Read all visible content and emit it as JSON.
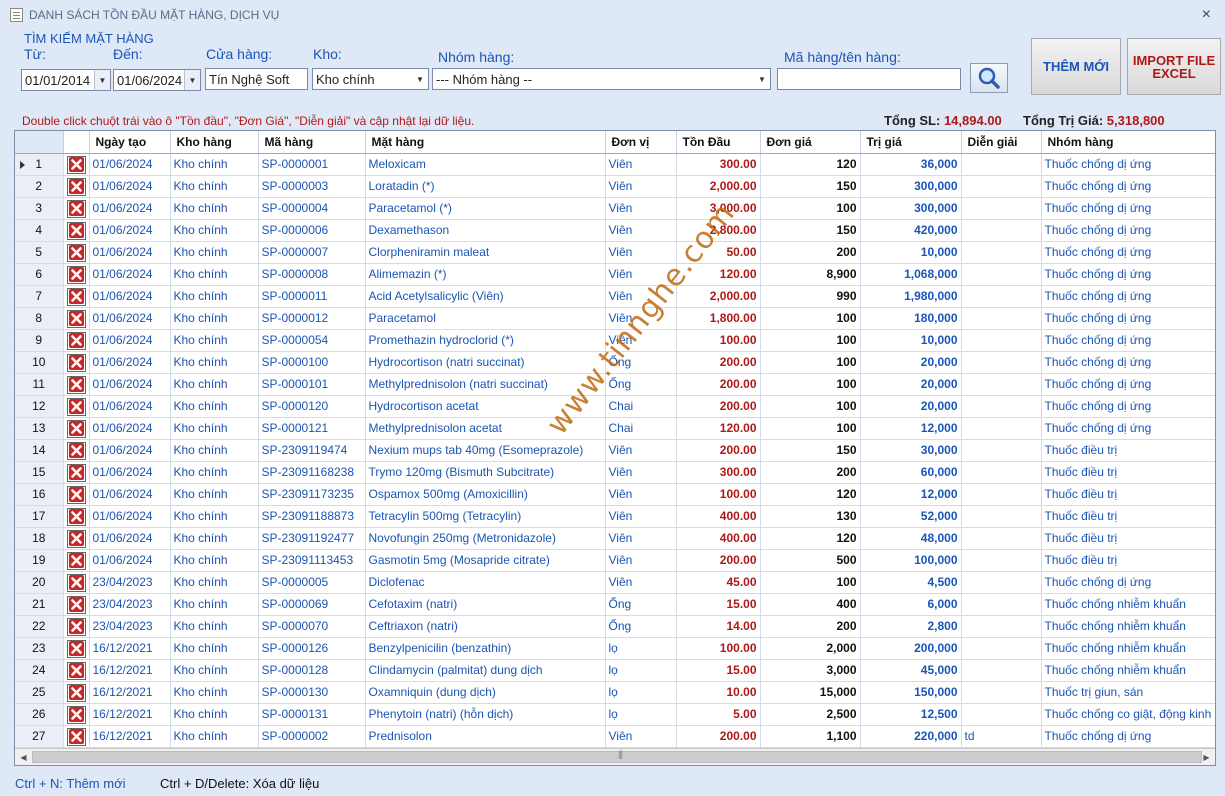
{
  "window": {
    "title": "DANH SÁCH TỒN ĐẦU MẶT HÀNG, DỊCH VỤ",
    "close": "×"
  },
  "search": {
    "section_label": "TÌM KIẾM MẶT HÀNG",
    "from_label": "Từ:",
    "to_label": "Đến:",
    "store_label": "Cửa hàng:",
    "warehouse_label": "Kho:",
    "group_label": "Nhóm hàng:",
    "code_label": "Mã hàng/tên hàng:",
    "from_value": "01/01/2014",
    "to_value": "01/06/2024",
    "store_value": "Tín Nghệ Soft",
    "warehouse_value": "Kho chính",
    "group_value": "--- Nhóm hàng --",
    "code_value": ""
  },
  "buttons": {
    "add_new": "THÊM MỚI",
    "import_line1": "IMPORT FILE",
    "import_line2": "EXCEL"
  },
  "hint": "Double click chuột trái vào ô \"Tồn đầu\", \"Đơn Giá\", \"Diễn giải\" và cập nhật lại dữ liệu.",
  "totals": {
    "qty_label": "Tổng SL:",
    "qty_value": "14,894.00",
    "value_label": "Tổng Trị Giá:",
    "value_value": "5,318,800"
  },
  "table": {
    "headers": {
      "date": "Ngày tạo",
      "warehouse": "Kho hàng",
      "code": "Mã hàng",
      "name": "Mặt hàng",
      "unit": "Đơn vị",
      "opening": "Tồn Đầu",
      "price": "Đơn giá",
      "value": "Trị giá",
      "note": "Diễn giải",
      "group": "Nhóm hàng"
    },
    "rows": [
      [
        "1",
        "01/06/2024",
        "Kho chính",
        "SP-0000001",
        "Meloxicam",
        "Viên",
        "300.00",
        "120",
        "36,000",
        "",
        "Thuốc chống dị ứng"
      ],
      [
        "2",
        "01/06/2024",
        "Kho chính",
        "SP-0000003",
        "Loratadin (*)",
        "Viên",
        "2,000.00",
        "150",
        "300,000",
        "",
        "Thuốc chống dị ứng"
      ],
      [
        "3",
        "01/06/2024",
        "Kho chính",
        "SP-0000004",
        "Paracetamol (*)",
        "Viên",
        "3,000.00",
        "100",
        "300,000",
        "",
        "Thuốc chống dị ứng"
      ],
      [
        "4",
        "01/06/2024",
        "Kho chính",
        "SP-0000006",
        "Dexamethason",
        "Viên",
        "2,800.00",
        "150",
        "420,000",
        "",
        "Thuốc chống dị ứng"
      ],
      [
        "5",
        "01/06/2024",
        "Kho chính",
        "SP-0000007",
        "Clorpheniramin maleat",
        "Viên",
        "50.00",
        "200",
        "10,000",
        "",
        "Thuốc chống dị ứng"
      ],
      [
        "6",
        "01/06/2024",
        "Kho chính",
        "SP-0000008",
        "Alimemazin (*)",
        "Viên",
        "120.00",
        "8,900",
        "1,068,000",
        "",
        "Thuốc chống dị ứng"
      ],
      [
        "7",
        "01/06/2024",
        "Kho chính",
        "SP-0000011",
        "Acid Acetylsalicylic (Viên)",
        "Viên",
        "2,000.00",
        "990",
        "1,980,000",
        "",
        "Thuốc chống dị ứng"
      ],
      [
        "8",
        "01/06/2024",
        "Kho chính",
        "SP-0000012",
        "Paracetamol",
        "Viên",
        "1,800.00",
        "100",
        "180,000",
        "",
        "Thuốc chống dị ứng"
      ],
      [
        "9",
        "01/06/2024",
        "Kho chính",
        "SP-0000054",
        "Promethazin hydroclorid (*)",
        "Viên",
        "100.00",
        "100",
        "10,000",
        "",
        "Thuốc chống dị ứng"
      ],
      [
        "10",
        "01/06/2024",
        "Kho chính",
        "SP-0000100",
        "Hydrocortison (natri succinat)",
        "Ống",
        "200.00",
        "100",
        "20,000",
        "",
        "Thuốc chống dị ứng"
      ],
      [
        "11",
        "01/06/2024",
        "Kho chính",
        "SP-0000101",
        "Methylprednisolon (natri succinat)",
        "Ống",
        "200.00",
        "100",
        "20,000",
        "",
        "Thuốc chống dị ứng"
      ],
      [
        "12",
        "01/06/2024",
        "Kho chính",
        "SP-0000120",
        "Hydrocortison acetat",
        "Chai",
        "200.00",
        "100",
        "20,000",
        "",
        "Thuốc chống dị ứng"
      ],
      [
        "13",
        "01/06/2024",
        "Kho chính",
        "SP-0000121",
        "Methylprednisolon acetat",
        "Chai",
        "120.00",
        "100",
        "12,000",
        "",
        "Thuốc chống dị ứng"
      ],
      [
        "14",
        "01/06/2024",
        "Kho chính",
        "SP-2309119474",
        "Nexium mups tab 40mg (Esomeprazole)",
        "Viên",
        "200.00",
        "150",
        "30,000",
        "",
        "Thuốc điều trị"
      ],
      [
        "15",
        "01/06/2024",
        "Kho chính",
        "SP-23091168238",
        "Trymo 120mg (Bismuth Subcitrate)",
        "Viên",
        "300.00",
        "200",
        "60,000",
        "",
        "Thuốc điều trị"
      ],
      [
        "16",
        "01/06/2024",
        "Kho chính",
        "SP-23091173235",
        "Ospamox 500mg (Amoxicillin)",
        "Viên",
        "100.00",
        "120",
        "12,000",
        "",
        "Thuốc điều trị"
      ],
      [
        "17",
        "01/06/2024",
        "Kho chính",
        "SP-23091188873",
        "Tetracylin 500mg (Tetracylin)",
        "Viên",
        "400.00",
        "130",
        "52,000",
        "",
        "Thuốc điều trị"
      ],
      [
        "18",
        "01/06/2024",
        "Kho chính",
        "SP-23091192477",
        "Novofungin 250mg (Metronidazole)",
        "Viên",
        "400.00",
        "120",
        "48,000",
        "",
        "Thuốc điều trị"
      ],
      [
        "19",
        "01/06/2024",
        "Kho chính",
        "SP-23091113453",
        "Gasmotin 5mg (Mosapride citrate)",
        "Viên",
        "200.00",
        "500",
        "100,000",
        "",
        "Thuốc điều trị"
      ],
      [
        "20",
        "23/04/2023",
        "Kho chính",
        "SP-0000005",
        "Diclofenac",
        "Viên",
        "45.00",
        "100",
        "4,500",
        "",
        "Thuốc chống dị ứng"
      ],
      [
        "21",
        "23/04/2023",
        "Kho chính",
        "SP-0000069",
        "Cefotaxim (natri)",
        "Ống",
        "15.00",
        "400",
        "6,000",
        "",
        "Thuốc chống nhiễm khuẩn"
      ],
      [
        "22",
        "23/04/2023",
        "Kho chính",
        "SP-0000070",
        "Ceftriaxon (natri)",
        "Ống",
        "14.00",
        "200",
        "2,800",
        "",
        "Thuốc chống nhiễm khuẩn"
      ],
      [
        "23",
        "16/12/2021",
        "Kho chính",
        "SP-0000126",
        "Benzylpenicilin (benzathin)",
        "lọ",
        "100.00",
        "2,000",
        "200,000",
        "",
        "Thuốc chống nhiễm khuẩn"
      ],
      [
        "24",
        "16/12/2021",
        "Kho chính",
        "SP-0000128",
        "Clindamycin (palmitat) dung dịch",
        "lọ",
        "15.00",
        "3,000",
        "45,000",
        "",
        "Thuốc chống nhiễm khuẩn"
      ],
      [
        "25",
        "16/12/2021",
        "Kho chính",
        "SP-0000130",
        "Oxamniquin (dung dịch)",
        "lọ",
        "10.00",
        "15,000",
        "150,000",
        "",
        "Thuốc trị giun, sán"
      ],
      [
        "26",
        "16/12/2021",
        "Kho chính",
        "SP-0000131",
        "Phenytoin (natri) (hỗn dịch)",
        "lọ",
        "5.00",
        "2,500",
        "12,500",
        "",
        "Thuốc chống co giật, động kinh"
      ],
      [
        "27",
        "16/12/2021",
        "Kho chính",
        "SP-0000002",
        "Prednisolon",
        "Viên",
        "200.00",
        "1,100",
        "220,000",
        "td",
        "Thuốc chống dị ứng"
      ]
    ]
  },
  "footer": {
    "shortcut_add": "Ctrl + N: Thêm mới",
    "shortcut_delete": "Ctrl + D/Delete:  Xóa dữ liệu"
  },
  "watermark": "www.tinnghe.com",
  "colors": {
    "accent": "#1b55b5",
    "value_red": "#b01818",
    "background": "#dfe8f6"
  }
}
